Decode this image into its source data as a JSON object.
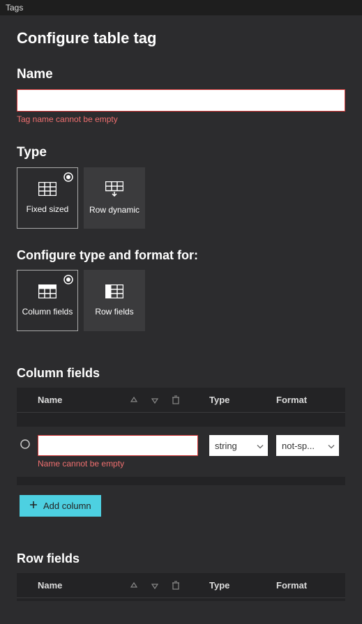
{
  "panel_title": "Tags",
  "page_title": "Configure table tag",
  "name_section": {
    "label": "Name",
    "value": "",
    "error": "Tag name cannot be empty"
  },
  "type_section": {
    "label": "Type",
    "options": [
      {
        "label": "Fixed sized",
        "selected": true
      },
      {
        "label": "Row dynamic",
        "selected": false
      }
    ]
  },
  "configure_section": {
    "label": "Configure type and format for:",
    "options": [
      {
        "label": "Column fields",
        "selected": true
      },
      {
        "label": "Row fields",
        "selected": false
      }
    ]
  },
  "column_fields": {
    "heading": "Column fields",
    "headers": {
      "name": "Name",
      "type": "Type",
      "format": "Format"
    },
    "row": {
      "name_value": "",
      "name_error": "Name cannot be empty",
      "type_value": "string",
      "format_value": "not-sp..."
    },
    "add_label": "Add column"
  },
  "row_fields": {
    "heading": "Row fields",
    "headers": {
      "name": "Name",
      "type": "Type",
      "format": "Format"
    }
  }
}
